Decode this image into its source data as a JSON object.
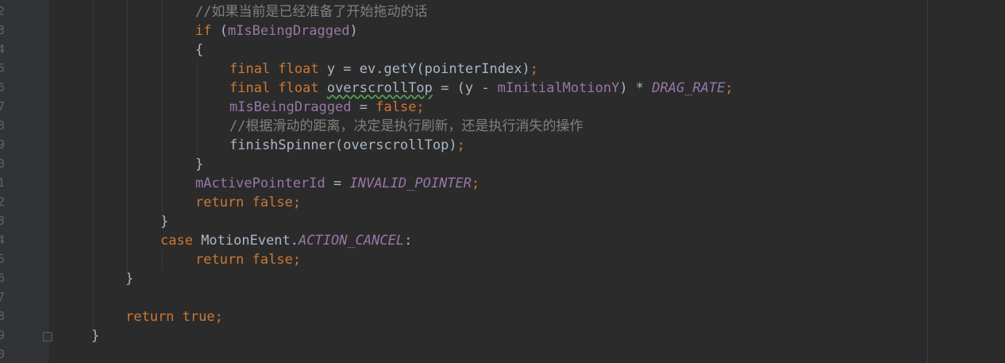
{
  "editor": {
    "line_numbers": [
      "2",
      "3",
      "4",
      "5",
      "6",
      "7",
      "8",
      "9",
      "0",
      "1",
      "2",
      "3",
      "4",
      "5",
      "6",
      "7",
      "8",
      "9",
      "0"
    ],
    "lines": [
      {
        "tokens": [
          {
            "t": "//如果当前是已经准备了开始拖动的话",
            "c": "cm"
          }
        ]
      },
      {
        "tokens": [
          {
            "t": "if",
            "c": "kw"
          },
          {
            "t": " ("
          },
          {
            "t": "mIsBeingDragged",
            "c": "fld"
          },
          {
            "t": ")"
          }
        ]
      },
      {
        "tokens": [
          {
            "t": "{"
          }
        ]
      },
      {
        "tokens": [
          {
            "t": "final float",
            "c": "kw"
          },
          {
            "t": " y = ev.getY(pointerIndex)"
          },
          {
            "t": ";",
            "c": "kw"
          }
        ]
      },
      {
        "tokens": [
          {
            "t": "final float",
            "c": "kw"
          },
          {
            "t": " "
          },
          {
            "t": "overscrollTop",
            "c": "typo"
          },
          {
            "t": " = (y - "
          },
          {
            "t": "mInitialMotionY",
            "c": "fld"
          },
          {
            "t": ") * "
          },
          {
            "t": "DRAG_RATE",
            "c": "cst"
          },
          {
            "t": ";",
            "c": "kw"
          }
        ]
      },
      {
        "tokens": [
          {
            "t": "mIsBeingDragged",
            "c": "fld"
          },
          {
            "t": " = "
          },
          {
            "t": "false;",
            "c": "kw"
          }
        ]
      },
      {
        "tokens": [
          {
            "t": "//根据滑动的距离，决定是执行刷新，还是执行消失的操作",
            "c": "cm"
          }
        ]
      },
      {
        "tokens": [
          {
            "t": "finishSpinner(overscrollTop)"
          },
          {
            "t": ";",
            "c": "kw"
          }
        ]
      },
      {
        "tokens": [
          {
            "t": "}"
          }
        ]
      },
      {
        "tokens": [
          {
            "t": "mActivePointerId",
            "c": "fld"
          },
          {
            "t": " = "
          },
          {
            "t": "INVALID_POINTER",
            "c": "cst"
          },
          {
            "t": ";",
            "c": "kw"
          }
        ]
      },
      {
        "tokens": [
          {
            "t": "return false;",
            "c": "kw"
          }
        ]
      },
      {
        "tokens": [
          {
            "t": "}"
          }
        ]
      },
      {
        "tokens": [
          {
            "t": "case",
            "c": "kw"
          },
          {
            "t": " MotionEvent."
          },
          {
            "t": "ACTION_CANCEL",
            "c": "cst"
          },
          {
            "t": ":"
          }
        ]
      },
      {
        "tokens": [
          {
            "t": "return false;",
            "c": "kw"
          }
        ]
      },
      {
        "tokens": [
          {
            "t": "}"
          }
        ]
      },
      {
        "tokens": []
      },
      {
        "tokens": [
          {
            "t": "return true;",
            "c": "kw"
          }
        ]
      },
      {
        "tokens": [
          {
            "t": "}"
          }
        ]
      },
      {
        "tokens": []
      }
    ],
    "colors": {
      "background": "#2b2b2b",
      "gutter": "#313335",
      "text": "#a9b7c6",
      "keyword": "#cc7832",
      "comment": "#808080",
      "field": "#9876aa",
      "line_number": "#606366"
    },
    "icons": [
      "fold-end-icon"
    ]
  }
}
